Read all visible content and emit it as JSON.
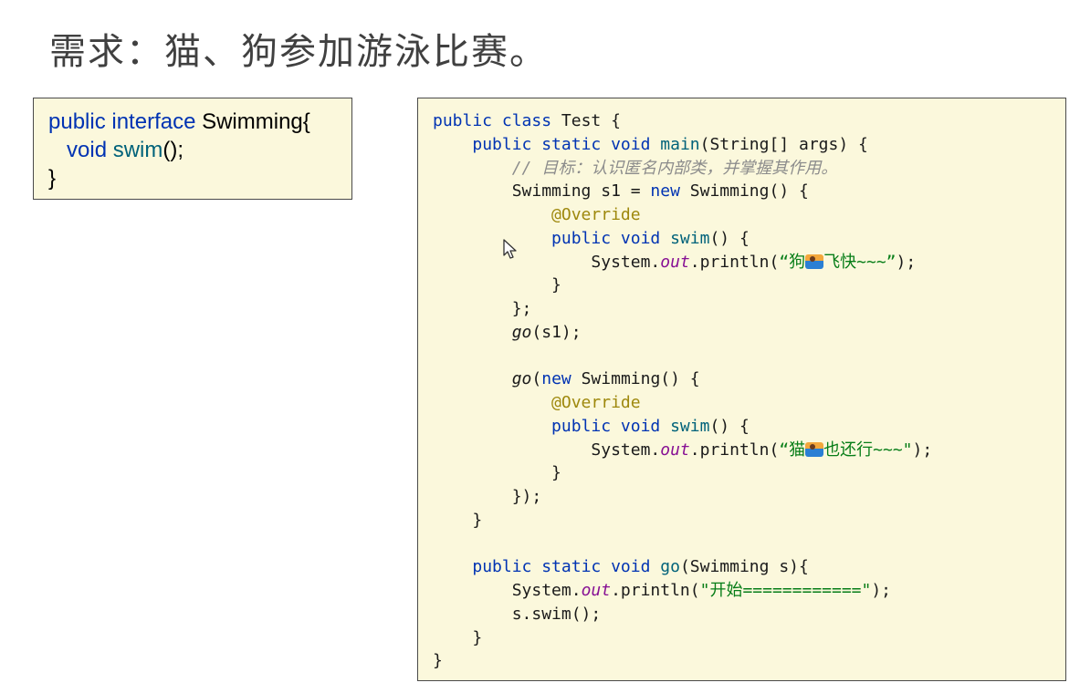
{
  "page": {
    "title": "需求：猫、狗参加游泳比赛。"
  },
  "interface_code": {
    "line1_kw": "public interface ",
    "line1_name": "Swimming{",
    "line2_indent": "   ",
    "line2_kw": "void ",
    "line2_fn": "swim",
    "line2_rest": "();",
    "line3": "}"
  },
  "test_code": {
    "l1_kw": "public class ",
    "l1_rest": "Test {",
    "l2_indent": "    ",
    "l2_kw": "public static void ",
    "l2_fn": "main",
    "l2_rest": "(String[] args) {",
    "l3_indent": "        ",
    "l3_cmt": "// 目标：认识匿名内部类，并掌握其作用。",
    "l4_indent": "        ",
    "l4_a": "Swimming s1 = ",
    "l4_kw": "new ",
    "l4_b": "Swimming() {",
    "l5_indent": "            ",
    "l5_ann": "@Override",
    "l6_indent": "            ",
    "l6_kw": "public void ",
    "l6_fn": "swim",
    "l6_rest": "() {",
    "l7_indent": "                ",
    "l7_a": "System.",
    "l7_out": "out",
    "l7_b": ".println(",
    "l7_str1": "“狗",
    "l7_str2": "飞快~~~”",
    "l7_c": ");",
    "l8_indent": "            ",
    "l8": "}",
    "l9_indent": "        ",
    "l9": "};",
    "l10_indent": "        ",
    "l10_go": "go",
    "l10_rest": "(s1);",
    "l11": "",
    "l12_indent": "        ",
    "l12_go": "go",
    "l12_a": "(",
    "l12_kw": "new ",
    "l12_b": "Swimming() {",
    "l13_indent": "            ",
    "l13_ann": "@Override",
    "l14_indent": "            ",
    "l14_kw": "public void ",
    "l14_fn": "swim",
    "l14_rest": "() {",
    "l15_indent": "                ",
    "l15_a": "System.",
    "l15_out": "out",
    "l15_b": ".println(",
    "l15_str1": "“猫",
    "l15_str2": "也还行~~~\"",
    "l15_c": ");",
    "l16_indent": "            ",
    "l16": "}",
    "l17_indent": "        ",
    "l17": "});",
    "l18_indent": "    ",
    "l18": "}",
    "l19": "",
    "l20_indent": "    ",
    "l20_kw": "public static void ",
    "l20_fn": "go",
    "l20_rest": "(Swimming s){",
    "l21_indent": "        ",
    "l21_a": "System.",
    "l21_out": "out",
    "l21_b": ".println(",
    "l21_str": "\"开始============\"",
    "l21_c": ");",
    "l22_indent": "        ",
    "l22": "s.swim();",
    "l23_indent": "    ",
    "l23": "}",
    "l24": "}"
  },
  "icons": {
    "emoji": "person-swimming-emoji",
    "cursor": "mouse-pointer-icon"
  }
}
